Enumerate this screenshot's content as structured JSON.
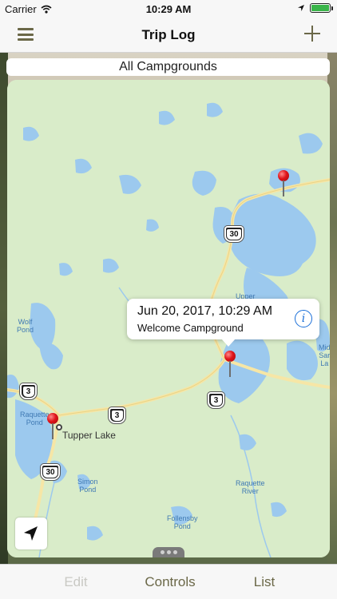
{
  "status_bar": {
    "carrier": "Carrier",
    "time": "10:29 AM",
    "battery_level": 1.0
  },
  "nav": {
    "title": "Trip Log",
    "menu_icon": "hamburger-icon",
    "add_icon": "plus-icon"
  },
  "filter": {
    "label": "All Campgrounds"
  },
  "map": {
    "water_labels": {
      "upper": "Upper",
      "wolf_pond": "Wolf\nPond",
      "raquette_pond": "Raquette\nPond",
      "simon_pond": "Simon\nPond",
      "raquette_river": "Raquette\nRiver",
      "follensby_pond": "Follensby\nPond",
      "mid_sar_la": "Mid\nSar\nLa"
    },
    "town": "Tupper Lake",
    "route_shields": {
      "top_30": "30",
      "left_3": "3",
      "mid_3": "3",
      "center_3": "3",
      "bottom_30": "30"
    },
    "callout": {
      "date": "Jun 20, 2017, 10:29 AM",
      "name": "Welcome Campground",
      "info_icon": "info-icon"
    },
    "locate_icon": "location-arrow-icon"
  },
  "tabs": {
    "edit": "Edit",
    "controls": "Controls",
    "list": "List"
  },
  "colors": {
    "accent": "#6b6848",
    "disabled": "#c9c9c4",
    "water": "#9cc9ee",
    "land": "#d9ecc9",
    "road": "#f6e6a6",
    "pin": "#e0141a",
    "link": "#1a6fd8"
  }
}
